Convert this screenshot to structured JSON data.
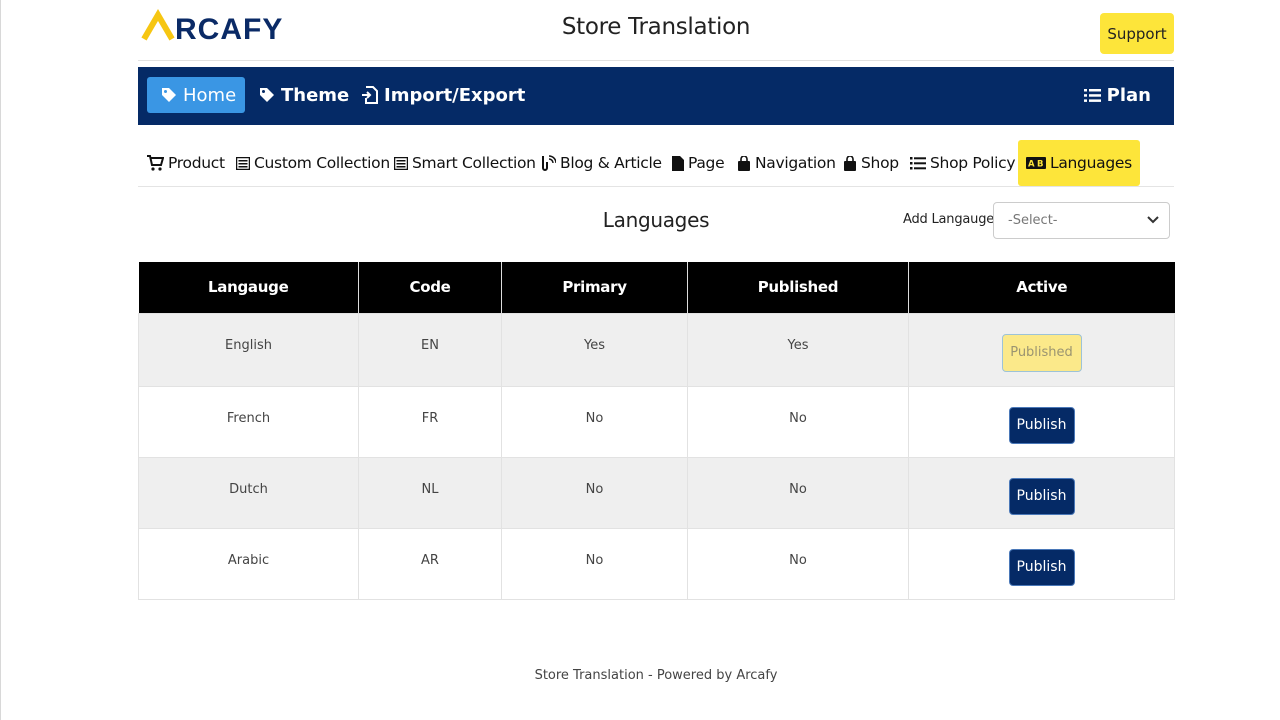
{
  "header": {
    "logo_text": "ARCAFY",
    "title": "Store Translation",
    "support_label": "Support"
  },
  "main_nav": {
    "items": [
      {
        "label": "Home",
        "icon": "tag-icon",
        "active": true
      },
      {
        "label": "Theme",
        "icon": "tag-icon"
      },
      {
        "label": "Import/Export",
        "icon": "file-import-icon"
      }
    ],
    "plan_label": "Plan"
  },
  "sub_tabs": [
    {
      "label": "Product",
      "icon": "cart-icon"
    },
    {
      "label": "Custom Collection",
      "icon": "list-icon"
    },
    {
      "label": "Smart Collection",
      "icon": "list-icon"
    },
    {
      "label": "Blog & Article",
      "icon": "blog-icon"
    },
    {
      "label": "Page",
      "icon": "file-icon"
    },
    {
      "label": "Navigation",
      "icon": "bag-icon"
    },
    {
      "label": "Shop",
      "icon": "bag-icon"
    },
    {
      "label": "Shop Policy",
      "icon": "list-ul-icon"
    },
    {
      "label": "Languages",
      "icon": "language-icon",
      "active": true
    }
  ],
  "section": {
    "title": "Languages",
    "add_label": "Add Langauge",
    "select_value": "-Select-"
  },
  "table": {
    "headers": [
      "Langauge",
      "Code",
      "Primary",
      "Published",
      "Active"
    ],
    "rows": [
      {
        "language": "English",
        "code": "EN",
        "primary": "Yes",
        "published": "Yes",
        "action": "Published"
      },
      {
        "language": "French",
        "code": "FR",
        "primary": "No",
        "published": "No",
        "action": "Publish"
      },
      {
        "language": "Dutch",
        "code": "NL",
        "primary": "No",
        "published": "No",
        "action": "Publish"
      },
      {
        "language": "Arabic",
        "code": "AR",
        "primary": "No",
        "published": "No",
        "action": "Publish"
      }
    ]
  },
  "footer": {
    "text": "Store Translation - Powered by Arcafy"
  },
  "colors": {
    "nav_bg": "#052a66",
    "home_active": "#3a96e4",
    "accent_yellow": "#fde53a",
    "logo_dark": "#0a2a66"
  }
}
